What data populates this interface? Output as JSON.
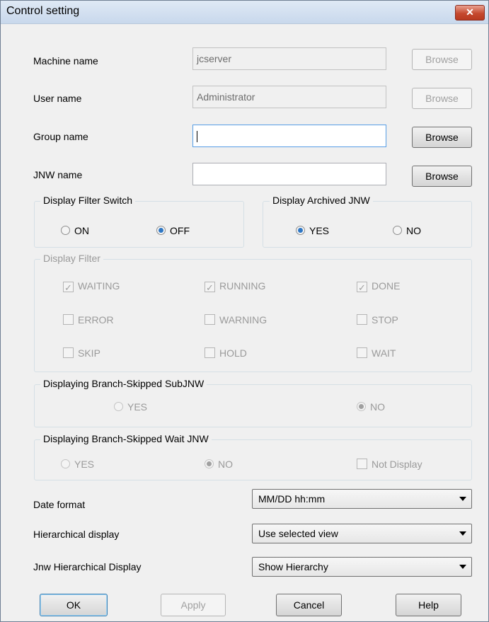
{
  "window": {
    "title": "Control setting",
    "close_glyph": "✕"
  },
  "fields": {
    "machine": {
      "label": "Machine name",
      "value": "jcserver",
      "browse": "Browse"
    },
    "user": {
      "label": "User name",
      "value": "Administrator",
      "browse": "Browse"
    },
    "group": {
      "label": "Group name",
      "value": "",
      "browse": "Browse"
    },
    "jnw": {
      "label": "JNW name",
      "value": "",
      "browse": "Browse"
    }
  },
  "display_filter_switch": {
    "title": "Display Filter Switch",
    "options": [
      "ON",
      "OFF"
    ],
    "selected": "OFF"
  },
  "display_archived": {
    "title": "Display Archived JNW",
    "options": [
      "YES",
      "NO"
    ],
    "selected": "YES"
  },
  "display_filter": {
    "title": "Display Filter",
    "items": [
      {
        "label": "WAITING",
        "checked": true
      },
      {
        "label": "RUNNING",
        "checked": true
      },
      {
        "label": "DONE",
        "checked": true
      },
      {
        "label": "ERROR",
        "checked": false
      },
      {
        "label": "WARNING",
        "checked": false
      },
      {
        "label": "STOP",
        "checked": false
      },
      {
        "label": "SKIP",
        "checked": false
      },
      {
        "label": "HOLD",
        "checked": false
      },
      {
        "label": "WAIT",
        "checked": false
      }
    ]
  },
  "branch_skipped_sub": {
    "title": "Displaying Branch-Skipped SubJNW",
    "options": [
      "YES",
      "NO"
    ],
    "selected": "NO"
  },
  "branch_skipped_wait": {
    "title": "Displaying Branch-Skipped Wait JNW",
    "options": [
      "YES",
      "NO"
    ],
    "selected": "NO",
    "checkbox": "Not Display"
  },
  "selects": {
    "date_format": {
      "label": "Date format",
      "value": "MM/DD hh:mm"
    },
    "hierarchical": {
      "label": "Hierarchical display",
      "value": "Use selected view"
    },
    "jnw_hierarchical": {
      "label": "Jnw Hierarchical Display",
      "value": "Show Hierarchy"
    }
  },
  "buttons": {
    "ok": "OK",
    "apply": "Apply",
    "cancel": "Cancel",
    "help": "Help"
  },
  "colors": {
    "accent": "#2f77c4",
    "close_button": "#c5492f",
    "focus_border": "#569de5"
  }
}
